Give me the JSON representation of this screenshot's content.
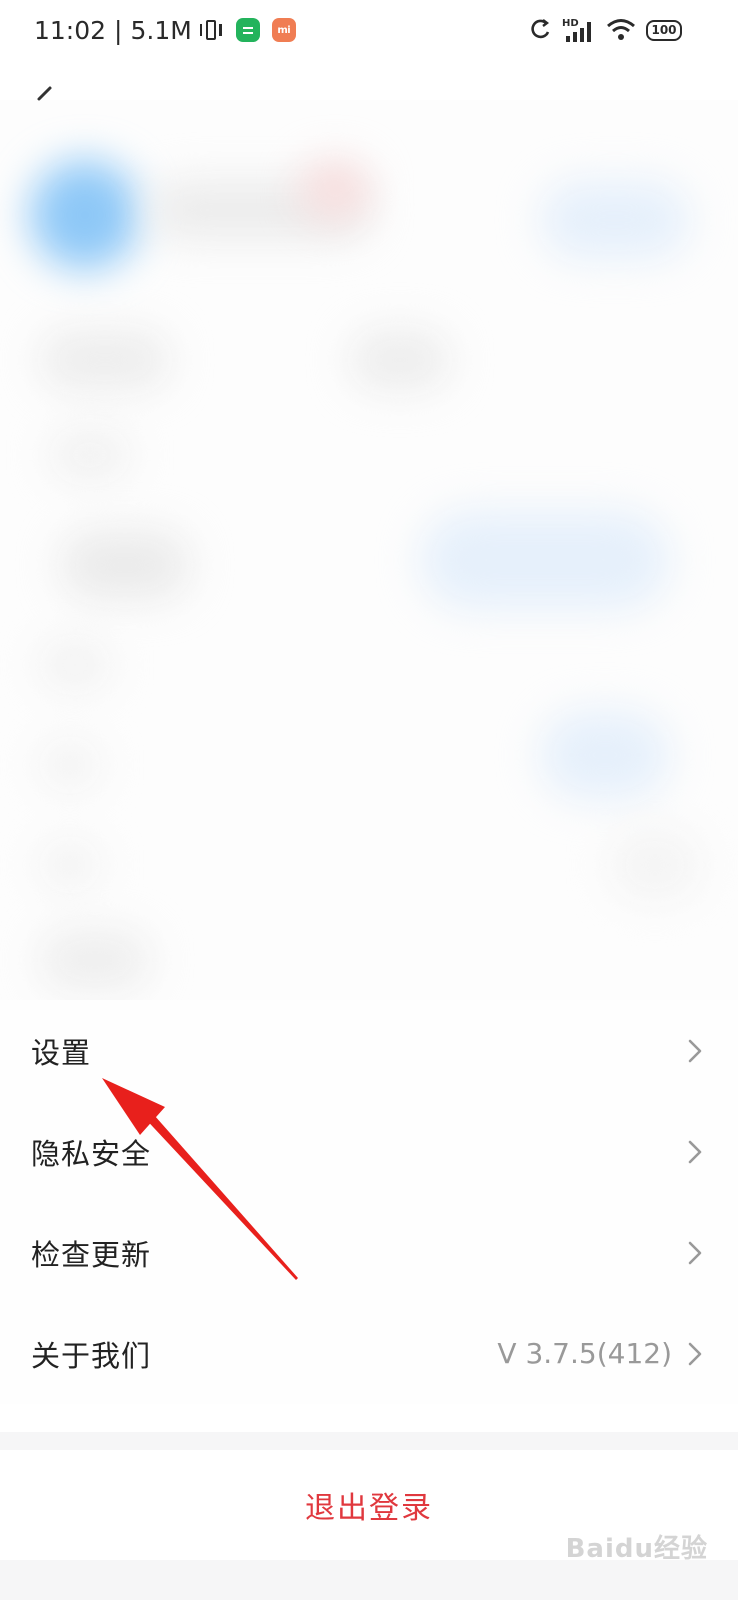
{
  "status_bar": {
    "time": "11:02",
    "separator": "|",
    "net_speed": "5.1M",
    "battery": "100",
    "icons": [
      "vibrate-icon",
      "message-app-icon",
      "mi-app-icon",
      "sync-icon",
      "hd-signal-icon",
      "wifi-icon",
      "battery-icon"
    ],
    "badge_colors": {
      "green": "#23b35c",
      "orange": "#f07d53"
    }
  },
  "menu": {
    "items": [
      {
        "label": "设置",
        "value": ""
      },
      {
        "label": "隐私安全",
        "value": ""
      },
      {
        "label": "检查更新",
        "value": ""
      },
      {
        "label": "关于我们",
        "value": "V 3.7.5(412)"
      }
    ]
  },
  "logout": {
    "label": "退出登录",
    "color": "#e0383e"
  },
  "annotation": {
    "arrow_color": "#e8201c"
  },
  "watermark": {
    "text": "Baidu经验"
  }
}
